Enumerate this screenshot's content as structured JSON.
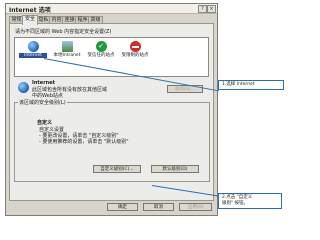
{
  "window": {
    "title": "Internet 选项"
  },
  "tabs": [
    "常规",
    "安全",
    "隐私",
    "内容",
    "连接",
    "程序",
    "高级"
  ],
  "security": {
    "instruction": "请为不同区域的 Web 内容指定安全设置(Z)",
    "zones": [
      {
        "label": "Internet",
        "icon": "globe-icon",
        "color": "#2f6fc8",
        "selected": true
      },
      {
        "label": "本地Intranet",
        "icon": "intranet-icon",
        "color": "#4a8a3a",
        "selected": false
      },
      {
        "label": "受信任的站点",
        "icon": "trusted-sites-icon",
        "color": "#1f9a3a",
        "selected": false
      },
      {
        "label": "受限制的站点",
        "icon": "restricted-sites-icon",
        "color": "#d42a2a",
        "selected": false
      }
    ],
    "zone_title": "Internet",
    "zone_desc_1": "此区域包含所有没有放在其他区域",
    "zone_desc_2": "中的Web站点",
    "sites_button": "站点(S)...",
    "level_group_title": "该区域的安全级别(L)",
    "custom_title": "自定义",
    "custom_lines": [
      "自定义设置",
      "- 要更改设置，请单击 \"自定义级别\"",
      "- 要使用推荐的设置，请单击 \"默认级别\""
    ],
    "custom_level_button": "自定义级别(C)...",
    "default_level_button": "默认级别(D)"
  },
  "footer": {
    "ok": "确定",
    "cancel": "取消",
    "apply": "应用(A)"
  },
  "callouts": {
    "first": "1.选择 Internet",
    "second_line1": "2.点击 \"自定义",
    "second_line2": "级别\" 按钮。"
  }
}
